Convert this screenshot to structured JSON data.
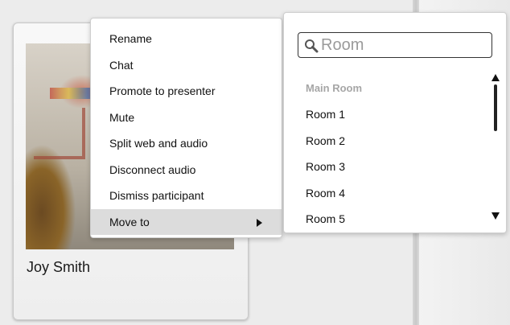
{
  "participant": {
    "name": "Joy Smith"
  },
  "context_menu": {
    "items": [
      {
        "label": "Rename"
      },
      {
        "label": "Chat"
      },
      {
        "label": "Promote to presenter"
      },
      {
        "label": "Mute"
      },
      {
        "label": "Split web and audio"
      },
      {
        "label": "Disconnect audio"
      },
      {
        "label": "Dismiss participant"
      },
      {
        "label": "Move to",
        "highlighted": true,
        "icon": "chevron-right-icon"
      }
    ]
  },
  "room_picker": {
    "search": {
      "placeholder": "Room",
      "value": "",
      "icon": "search-icon"
    },
    "header": "Main Room",
    "rooms": [
      "Room 1",
      "Room 2",
      "Room 3",
      "Room 4",
      "Room 5"
    ],
    "scroll_icons": [
      "scroll-up-icon",
      "scroll-down-icon"
    ]
  },
  "colors": {
    "menu_highlight": "#dcdcdc",
    "header_text": "#a6a6a6",
    "background": "#ececec"
  }
}
